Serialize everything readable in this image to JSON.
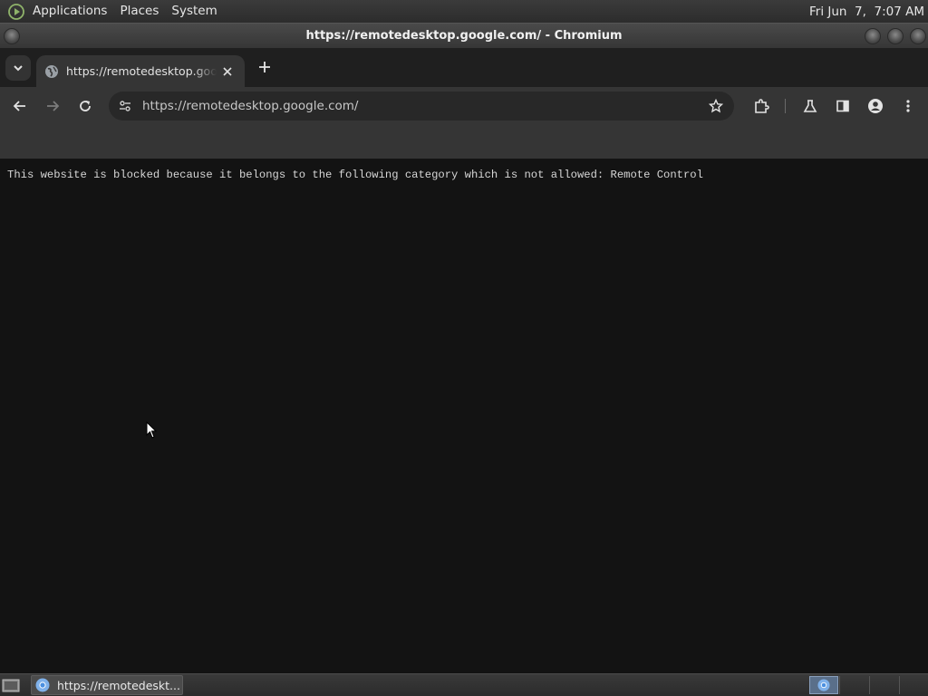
{
  "top_panel": {
    "menus": [
      "Applications",
      "Places",
      "System"
    ],
    "clock": "Fri Jun  7,  7:07 AM"
  },
  "window": {
    "title": "https://remotedesktop.google.com/ - Chromium"
  },
  "browser": {
    "tab": {
      "title": "https://remotedesktop.google.com/"
    },
    "omnibox": {
      "url": "https://remotedesktop.google.com/"
    }
  },
  "page": {
    "message": "This website is blocked because it belongs to the following category which is not allowed: Remote Control"
  },
  "taskbar": {
    "task_label": "https://remotedeskt..."
  },
  "colors": {
    "accent_chrome_blue": "#4a8fe0",
    "page_background": "#131313"
  }
}
